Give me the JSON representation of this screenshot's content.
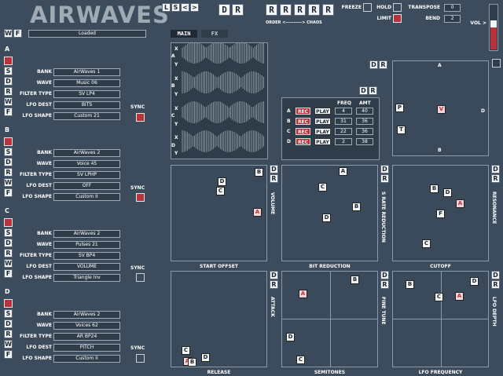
{
  "app": {
    "title": "AIRWAVES",
    "status": "Loaded"
  },
  "top": {
    "wf": [
      "W",
      "F"
    ],
    "ls_buttons": [
      "L",
      "S",
      "<",
      ">"
    ],
    "dr_buttons": [
      "D",
      "R"
    ],
    "r_buttons": [
      "R",
      "R",
      "R",
      "R",
      "R"
    ],
    "order_label": "ORDER <----------> CHAOS",
    "freeze_label": "FREEZE",
    "hold_label": "HOLD",
    "limit_label": "LIMIT",
    "transpose_label": "TRANSPOSE",
    "transpose_value": "0",
    "bend_label": "BEND",
    "bend_value": "2",
    "vol_label": "VOL >",
    "tabs": [
      "MAIN",
      "FX"
    ]
  },
  "field_labels": {
    "bank": "BANK",
    "wave": "WAVE",
    "filter_type": "FILTER TYPE",
    "lfo_dest": "LFO DEST",
    "lfo_shape": "LFO SHAPE",
    "sync": "SYNC"
  },
  "side_letters": [
    "S",
    "D",
    "R",
    "W",
    "F"
  ],
  "sections": [
    {
      "name": "A",
      "bank": "AirWaves 1",
      "wave": "Music 06",
      "filter": "SV LP4",
      "lfo_dest": "BITS",
      "lfo_shape": "Custom 21",
      "sync": true
    },
    {
      "name": "B",
      "bank": "AirWaves 2",
      "wave": "Voice 45",
      "filter": "SV LPHP",
      "lfo_dest": "OFF",
      "lfo_shape": "Custom II",
      "sync": true
    },
    {
      "name": "C",
      "bank": "AirWaves 2",
      "wave": "Pulses 21",
      "filter": "SV BP4",
      "lfo_dest": "VOLUME",
      "lfo_shape": "Triangle Inv",
      "sync": false
    },
    {
      "name": "D",
      "bank": "AirWaves 2",
      "wave": "Voices 62",
      "filter": "AR BP24",
      "lfo_dest": "PITCH",
      "lfo_shape": "Custom II",
      "sync": false
    }
  ],
  "wave_axes": [
    "X",
    "A",
    "Y",
    "X",
    "B",
    "Y",
    "X",
    "C",
    "Y",
    "X",
    "D",
    "Y"
  ],
  "sequencer": {
    "headers": [
      "FREQ",
      "AMT"
    ],
    "rec": "REC",
    "play": "PLAY",
    "rows": [
      {
        "name": "A",
        "freq": "4",
        "amt": "40"
      },
      {
        "name": "B",
        "freq": "31",
        "amt": "36"
      },
      {
        "name": "C",
        "freq": "22",
        "amt": "36"
      },
      {
        "name": "D",
        "freq": "2",
        "amt": "38"
      }
    ]
  },
  "xy_pad": {
    "corner_a": "A",
    "corner_b": "B",
    "corner_d": "D",
    "nodes": [
      "P",
      "V",
      "T"
    ]
  },
  "pads": [
    {
      "id": "volume",
      "side": "VOLUME",
      "bottom": "START OFFSET",
      "nodes": [
        "B",
        "D",
        "C",
        "A"
      ]
    },
    {
      "id": "rate",
      "side": "S RATE REDUCTION",
      "bottom": "BIT REDUCTION",
      "nodes": [
        "A",
        "C",
        "B",
        "D"
      ]
    },
    {
      "id": "resonance",
      "side": "RESONANCE",
      "bottom": "CUTOFF",
      "nodes": [
        "B",
        "D",
        "A",
        "F",
        "C"
      ]
    },
    {
      "id": "attack",
      "side": "ATTACK",
      "bottom": "RELEASE",
      "nodes": [
        "C",
        "A",
        "B",
        "D"
      ]
    },
    {
      "id": "finetune",
      "side": "FINE TUNE",
      "bottom": "SEMITONES",
      "nodes": [
        "B",
        "A",
        "D",
        "C"
      ]
    },
    {
      "id": "lfodepth",
      "side": "LFO DEPTH",
      "bottom": "LFO FREQUENCY",
      "nodes": [
        "D",
        "B",
        "C",
        "A"
      ]
    }
  ],
  "colors": {
    "background": "#3c4c5c",
    "accent_red": "#b8323c",
    "panel": "#2f3d4b"
  }
}
